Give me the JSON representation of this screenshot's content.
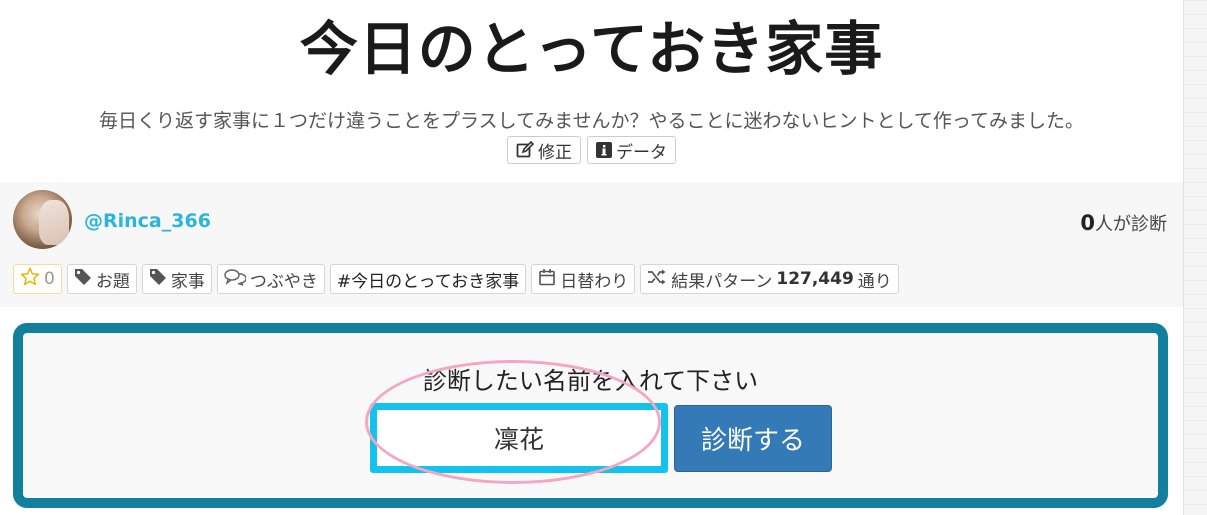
{
  "page": {
    "title": "今日のとっておき家事",
    "description": "毎日くり返す家事に１つだけ違うことをプラスしてみませんか？やることに迷わないヒントとして作ってみました。",
    "edit_label": "修正",
    "data_label": "データ"
  },
  "author": {
    "handle": "@Rinca_366",
    "diagnosed_count": "0",
    "diagnosed_suffix": "人が診断"
  },
  "tags": {
    "favorites": "0",
    "odai": "お題",
    "kaji": "家事",
    "tsubuyaki": "つぶやき",
    "hashtag": "#今日のとっておき家事",
    "daily": "日替わり",
    "patterns_prefix": "結果パターン",
    "patterns_count": "127,449",
    "patterns_suffix": "通り"
  },
  "form": {
    "prompt": "診断したい名前を入れて下さい",
    "name_value": "凜花",
    "submit_label": "診断する"
  },
  "colors": {
    "accent": "#2ab6dc",
    "form_border": "#127f9d",
    "input_border": "#14c3ec",
    "button": "#337ab7",
    "annotation": "#f4a7c4"
  },
  "icons": {
    "edit": "edit-icon",
    "info": "info-icon",
    "star": "star-icon",
    "tag": "tag-icon",
    "chat": "chat-icon",
    "calendar": "calendar-icon",
    "shuffle": "shuffle-icon"
  }
}
